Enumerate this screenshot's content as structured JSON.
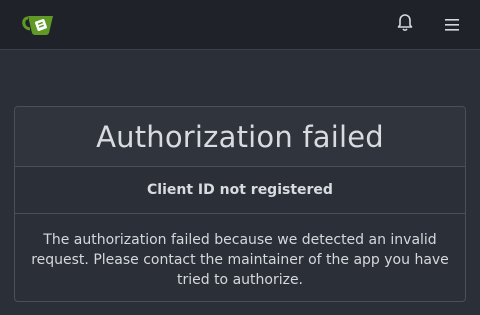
{
  "navbar": {
    "logo_icon": "gitea-teacup-logo",
    "notifications_icon": "bell-icon",
    "menu_icon": "hamburger-menu-icon"
  },
  "card": {
    "title": "Authorization failed",
    "subtitle": "Client ID not registered",
    "message": "The authorization failed because we detected an invalid request. Please contact the maintainer of the app you have tried to authorize."
  },
  "colors": {
    "navbar_bg": "#1f2329",
    "page_bg": "#2b3038",
    "logo_green": "#609926",
    "border": "#4a5059"
  }
}
